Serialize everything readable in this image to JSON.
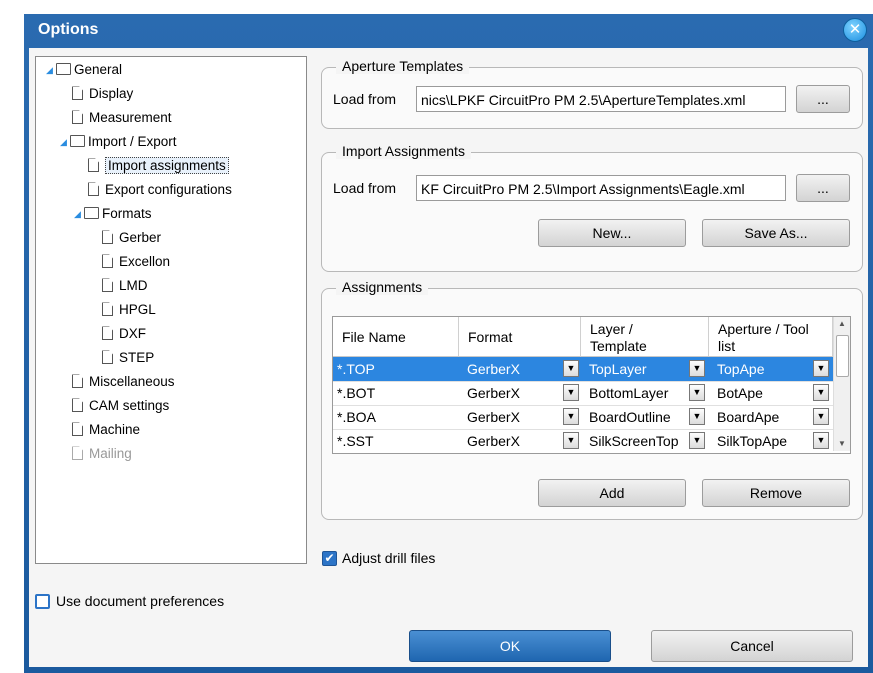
{
  "window": {
    "title": "Options"
  },
  "tree": {
    "items": [
      {
        "label": "General"
      },
      {
        "label": "Display"
      },
      {
        "label": "Measurement"
      },
      {
        "label": "Import / Export"
      },
      {
        "label": "Import assignments"
      },
      {
        "label": "Export configurations"
      },
      {
        "label": "Formats"
      },
      {
        "label": "Gerber"
      },
      {
        "label": "Excellon"
      },
      {
        "label": "LMD"
      },
      {
        "label": "HPGL"
      },
      {
        "label": "DXF"
      },
      {
        "label": "STEP"
      },
      {
        "label": "Miscellaneous"
      },
      {
        "label": "CAM settings"
      },
      {
        "label": "Machine"
      },
      {
        "label": "Mailing"
      }
    ]
  },
  "aperture_templates": {
    "title": "Aperture Templates",
    "load_label": "Load from",
    "path": "nics\\LPKF CircuitPro PM 2.5\\ApertureTemplates.xml",
    "browse_label": "..."
  },
  "import_assignments": {
    "title": "Import Assignments",
    "load_label": "Load from",
    "path": "KF CircuitPro PM 2.5\\Import Assignments\\Eagle.xml",
    "browse_label": "...",
    "new_label": "New...",
    "save_as_label": "Save As..."
  },
  "assignments": {
    "title": "Assignments",
    "columns": [
      "File Name",
      "Format",
      "Layer / Template",
      "Aperture / Tool list"
    ],
    "column_lines": [
      [
        "File Name"
      ],
      [
        "Format"
      ],
      [
        "Layer /",
        "Template"
      ],
      [
        "Aperture / Tool",
        "list"
      ]
    ],
    "rows": [
      {
        "file": "*.TOP",
        "format": "GerberX",
        "layer": "TopLayer",
        "aperture": "TopApe"
      },
      {
        "file": "*.BOT",
        "format": "GerberX",
        "layer": "BottomLayer",
        "aperture": "BotApe"
      },
      {
        "file": "*.BOA",
        "format": "GerberX",
        "layer": "BoardOutline",
        "aperture": "BoardApe"
      },
      {
        "file": "*.SST",
        "format": "GerberX",
        "layer": "SilkScreenTop",
        "aperture": "SilkTopApe"
      }
    ],
    "selected_row": 0,
    "add_label": "Add",
    "remove_label": "Remove"
  },
  "adjust_drill": {
    "label": "Adjust drill files",
    "checked": true
  },
  "use_doc_prefs": {
    "label": "Use document preferences",
    "checked": false
  },
  "buttons": {
    "ok": "OK",
    "cancel": "Cancel"
  },
  "colors": {
    "title_bar": "#1f5fa3",
    "selection": "#2c86e0",
    "tree_arrow": "#2a8de0"
  }
}
